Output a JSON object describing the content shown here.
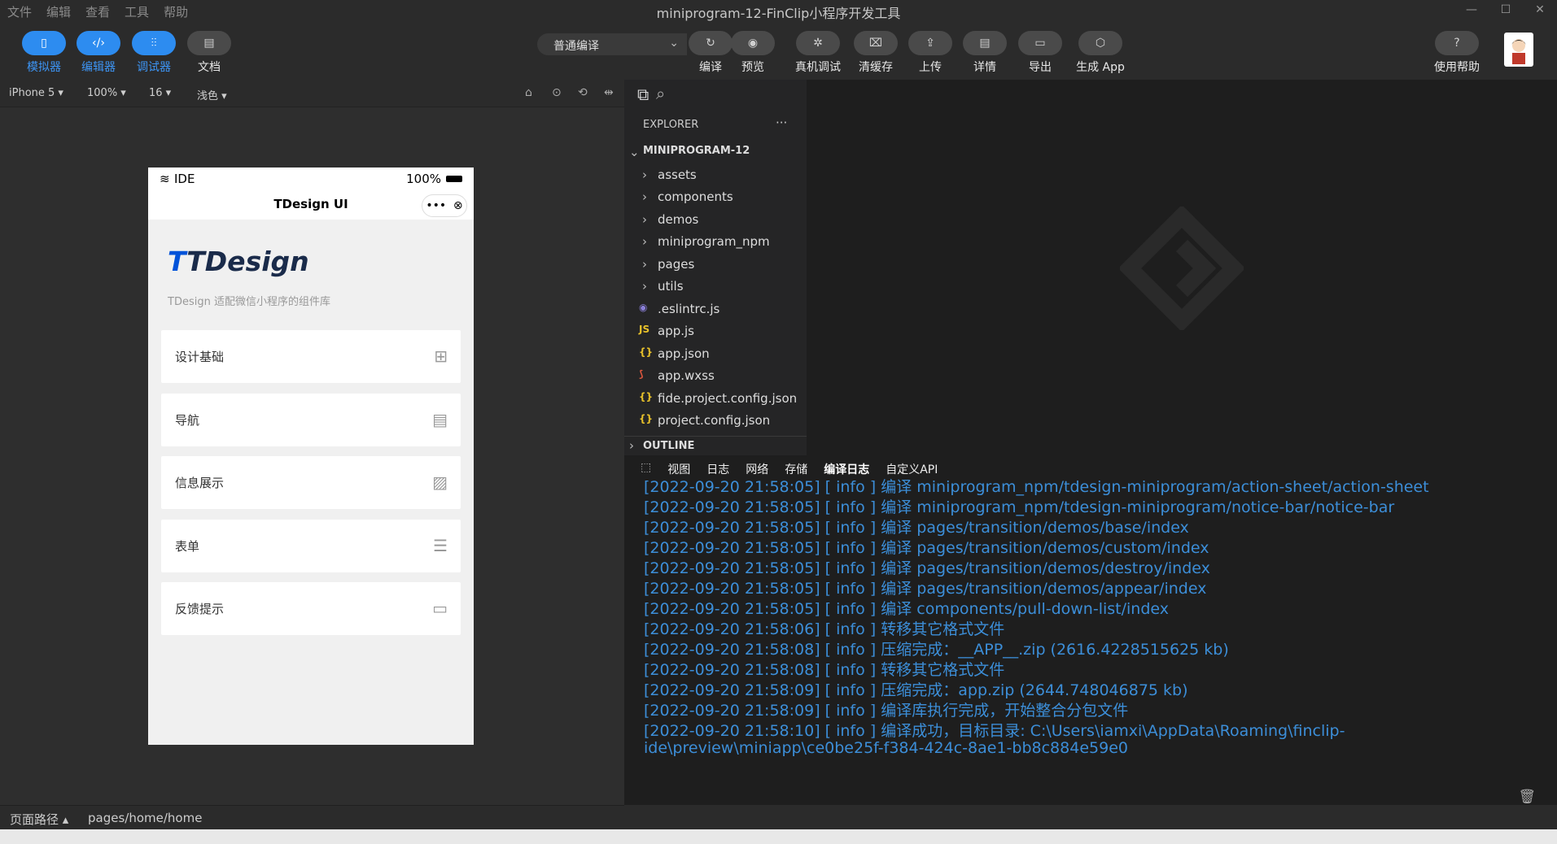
{
  "menu": [
    "文件",
    "编辑",
    "查看",
    "工具",
    "帮助"
  ],
  "window_title": "miniprogram-12-FinClip小程序开发工具",
  "window_controls": [
    "—",
    "☐",
    "✕"
  ],
  "toolbar": {
    "simulator": "模拟器",
    "editor": "编辑器",
    "debugger": "调试器",
    "docs": "文档",
    "compile_mode": "普通编译",
    "compile": "编译",
    "preview": "预览",
    "device_debug": "真机调试",
    "clear_cache": "清缓存",
    "upload": "上传",
    "details": "详情",
    "export": "导出",
    "generate_app": "生成 App",
    "help": "使用帮助"
  },
  "subbar": {
    "device": "iPhone 5",
    "zoom": "100%",
    "font": "16",
    "theme": "浅色"
  },
  "phone": {
    "carrier": "IDE",
    "battery": "100%",
    "nav_title": "TDesign UI",
    "capsule_more": "•••",
    "capsule_close": "⊗",
    "logo_t": "T",
    "logo_text": "TDesign",
    "desc": "TDesign 适配微信小程序的组件库",
    "cards": [
      {
        "label": "设计基础",
        "icon": "grid-icon"
      },
      {
        "label": "导航",
        "icon": "document-icon"
      },
      {
        "label": "信息展示",
        "icon": "image-icon"
      },
      {
        "label": "表单",
        "icon": "list-icon"
      },
      {
        "label": "反馈提示",
        "icon": "chat-icon"
      }
    ]
  },
  "path_bar": {
    "label": "页面路径",
    "value": "pages/home/home"
  },
  "explorer": {
    "header": "EXPLORER",
    "more": "···",
    "project": "MINIPROGRAM-12",
    "folders": [
      "assets",
      "components",
      "demos",
      "miniprogram_npm",
      "pages",
      "utils"
    ],
    "files": [
      {
        "name": ".eslintrc.js",
        "badge": "◉",
        "color": "#8a7fd8"
      },
      {
        "name": "app.js",
        "badge": "JS",
        "color": "#e8c12a"
      },
      {
        "name": "app.json",
        "badge": "{}",
        "color": "#e8c12a"
      },
      {
        "name": "app.wxss",
        "badge": "⟆",
        "color": "#e0573e"
      },
      {
        "name": "fide.project.config.json",
        "badge": "{}",
        "color": "#e8c12a"
      },
      {
        "name": "project.config.json",
        "badge": "{}",
        "color": "#e8c12a"
      }
    ],
    "outline": "OUTLINE"
  },
  "console": {
    "tabs": [
      "视图",
      "日志",
      "网络",
      "存储",
      "编译日志",
      "自定义API"
    ],
    "active_tab": "编译日志",
    "lines": [
      "[2022-09-20 21:58:05]  [ info ] 编译 miniprogram_npm/tdesign-miniprogram/action-sheet/action-sheet",
      "[2022-09-20 21:58:05]  [ info ] 编译 miniprogram_npm/tdesign-miniprogram/notice-bar/notice-bar",
      "[2022-09-20 21:58:05]  [ info ] 编译 pages/transition/demos/base/index",
      "[2022-09-20 21:58:05]  [ info ] 编译 pages/transition/demos/custom/index",
      "[2022-09-20 21:58:05]  [ info ] 编译 pages/transition/demos/destroy/index",
      "[2022-09-20 21:58:05]  [ info ] 编译 pages/transition/demos/appear/index",
      "[2022-09-20 21:58:05]  [ info ] 编译 components/pull-down-list/index",
      "[2022-09-20 21:58:06]  [ info ] 转移其它格式文件",
      "[2022-09-20 21:58:08]  [ info ] 压缩完成：__APP__.zip (2616.4228515625 kb)",
      "[2022-09-20 21:58:08]  [ info ] 转移其它格式文件",
      "[2022-09-20 21:58:09]  [ info ] 压缩完成：app.zip (2644.748046875 kb)",
      "[2022-09-20 21:58:09]  [ info ] 编译库执行完成，开始整合分包文件",
      "[2022-09-20 21:58:10]  [ info ] 编译成功，目标目录: C:\\Users\\iamxi\\AppData\\Roaming\\finclip-",
      "ide\\preview\\miniapp\\ce0be25f-f384-424c-8ae1-bb8c884e59e0"
    ]
  },
  "colors": {
    "accent": "#2d8cf0",
    "log": "#3c8ed8",
    "bg": "#2b2b2b",
    "editor_bg": "#1e1e1e"
  }
}
